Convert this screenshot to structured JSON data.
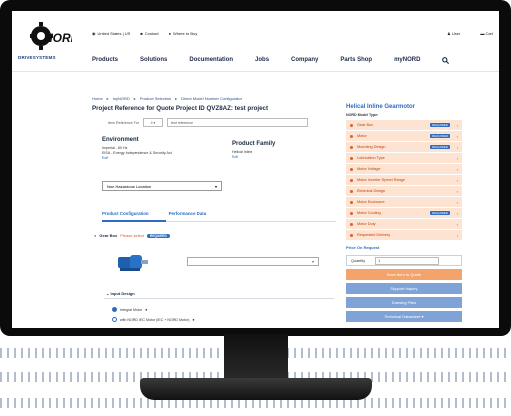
{
  "header": {
    "top_links": [
      "United States | US",
      "Contact",
      "Where to Buy"
    ],
    "top_right": [
      "User",
      "Cart"
    ],
    "brand": "DRIVESYSTEMS",
    "logo_text": "NORD",
    "nav": [
      "Products",
      "Solutions",
      "Documentation",
      "Jobs",
      "Company",
      "Parts Shop",
      "myNORD"
    ],
    "search_icon": "search-icon"
  },
  "breadcrumb": [
    "Home",
    "myNORD",
    "Product Selection",
    "Direct Model Number Configurator"
  ],
  "page": {
    "title": "Project Reference for Quote Project ID QVZ8AZ: test project",
    "item_ref_label": "Item Reference For",
    "item_ref_select": "4",
    "item_ref_value": "test reference"
  },
  "environment": {
    "heading": "Environment",
    "lines": [
      "Imperial - 60 Hz",
      "EISA - Energy Independence & Security Act"
    ],
    "edit": "Edit"
  },
  "product_family": {
    "heading": "Product Family",
    "line": "Helical Inline",
    "edit": "Edit"
  },
  "location_select": "Non Hazardous Location",
  "tabs": [
    "Product Configuration",
    "Performance Data"
  ],
  "gearbox": {
    "label": "Gear Box",
    "required": "Please select",
    "badge": "REQUIRED"
  },
  "input_design": {
    "heading": "Input Design",
    "options": [
      "Integral Motor",
      "with NORD IEC Motor (IEC + NORD Motor)"
    ]
  },
  "right_panel": {
    "heading": "Helical Inline Gearmotor",
    "subheading": "NORD Model Type:",
    "items": [
      {
        "label": "Gear Box",
        "badge": "REQUIRED"
      },
      {
        "label": "Motor",
        "badge": "REQUIRED"
      },
      {
        "label": "Mounting Design",
        "badge": "REQUIRED"
      },
      {
        "label": "Lubrication Type",
        "badge": ""
      },
      {
        "label": "Motor Voltage",
        "badge": ""
      },
      {
        "label": "Motor Inverter Speed Range",
        "badge": ""
      },
      {
        "label": "Electrical Design",
        "badge": ""
      },
      {
        "label": "Motor Enclosure",
        "badge": ""
      },
      {
        "label": "Motor Cooling",
        "badge": "REQUIRED"
      },
      {
        "label": "Motor Duty",
        "badge": ""
      },
      {
        "label": "Requested Delivery",
        "badge": ""
      }
    ],
    "price_heading": "Price On Request",
    "quantity_label": "Quantity",
    "quantity_value": "1",
    "buttons": [
      "Save Item to Quote",
      "Support Inquiry",
      "Drawing Files",
      "Technical Datasheet"
    ]
  },
  "colors": {
    "accent": "#2d6cc0",
    "orange": "#f2a46c",
    "row_tint": "#fde3d1"
  }
}
